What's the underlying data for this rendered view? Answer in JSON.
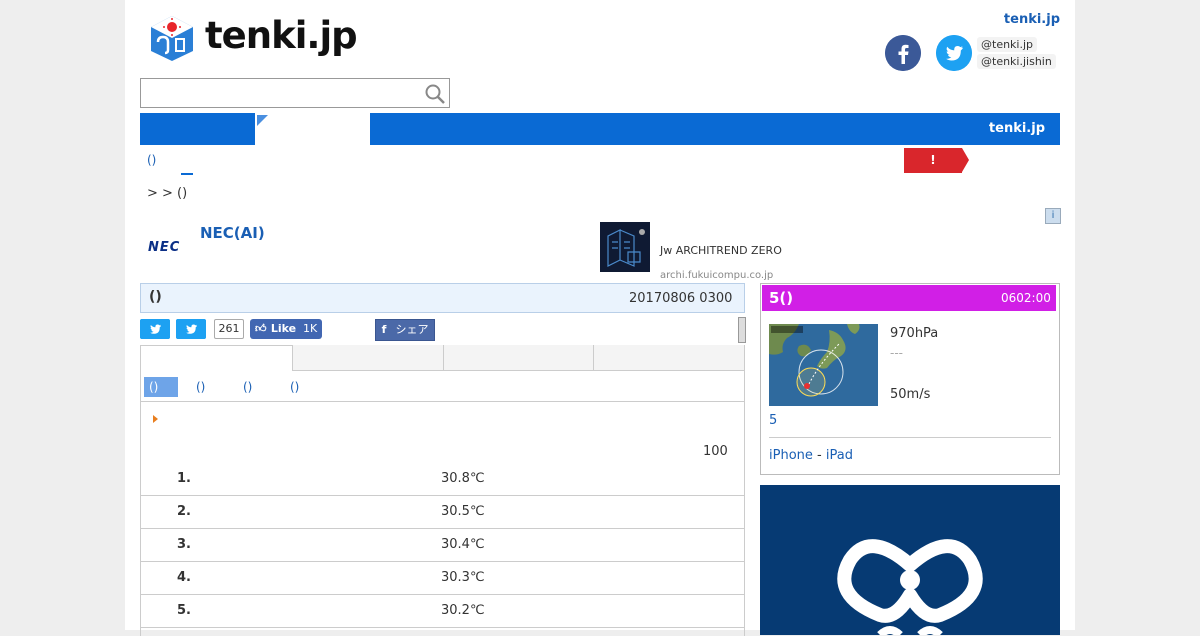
{
  "header": {
    "logo_text": "tenki.jp",
    "brand_top": "tenki.jp",
    "sns_accounts": [
      "@tenki.jp",
      "@tenki.jishin"
    ]
  },
  "search": {
    "placeholder": ""
  },
  "nav": {
    "brand": "tenki.jp"
  },
  "subnav": {
    "link": "()",
    "alert_label": "!"
  },
  "breadcrumb": ">  > ()",
  "ads": {
    "nec_logo": "NEC",
    "ad1_title": "NEC(AI)",
    "ad2_title": "Jw ARCHITREND ZERO",
    "ad2_url": "archi.fukuicompu.co.jp",
    "adchoice": "i"
  },
  "main": {
    "title": "()",
    "date": "20170806 0300",
    "share_count": "261",
    "like_label": "Like",
    "like_count": "1K",
    "fb_share": "シェア",
    "subtabs": [
      "()",
      "()",
      "()",
      "()"
    ],
    "total": "100",
    "ranking": [
      {
        "rank": "1.",
        "temp": "30.8℃"
      },
      {
        "rank": "2.",
        "temp": "30.5℃"
      },
      {
        "rank": "3.",
        "temp": "30.4℃"
      },
      {
        "rank": "4.",
        "temp": "30.3℃"
      },
      {
        "rank": "5.",
        "temp": "30.2℃"
      }
    ]
  },
  "typhoon": {
    "title": "5()",
    "time": "0602:00",
    "pressure": "970hPa",
    "dash": "---",
    "wind": "50m/s",
    "link": "5",
    "apps": [
      "iPhone",
      "-",
      "iPad"
    ]
  },
  "colors": {
    "nav_blue": "#0a6ad4",
    "typhoon_magenta": "#d11fe6",
    "alert_red": "#d9262c",
    "banner_navy": "#063a73"
  }
}
